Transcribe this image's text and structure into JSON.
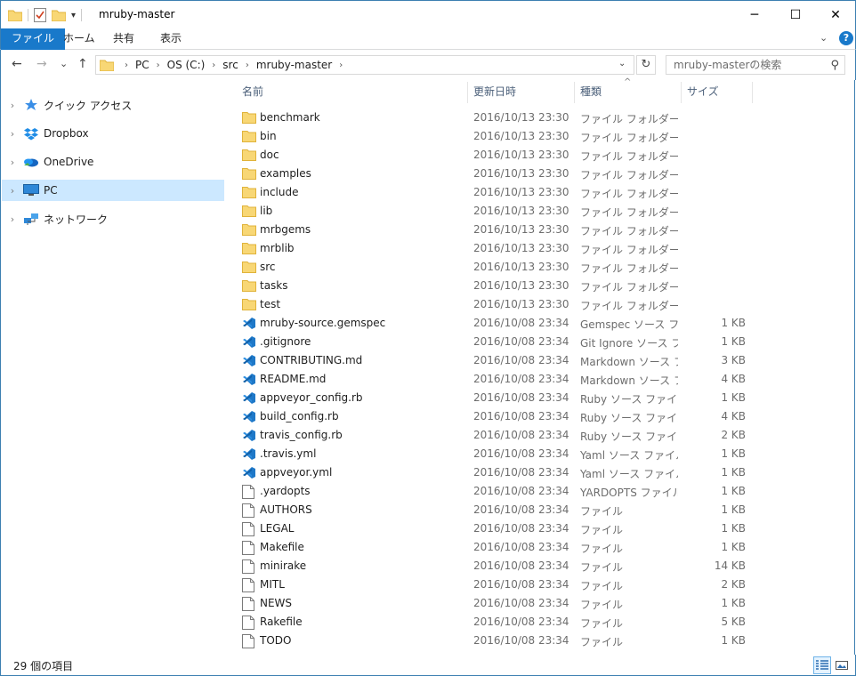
{
  "window": {
    "title": "mruby-master",
    "minimize": "─",
    "maximize": "☐",
    "close": "✕"
  },
  "ribbon": {
    "tabs": [
      "ファイル",
      "ホーム",
      "共有",
      "表示"
    ],
    "expand": "⌄",
    "help": "?"
  },
  "address": {
    "back": "←",
    "forward": "→",
    "recent": "⌄",
    "up": "↑",
    "crumbs": [
      "PC",
      "OS (C:)",
      "src",
      "mruby-master"
    ],
    "dropdown": "⌄",
    "refresh": "↻",
    "search_placeholder": "mruby-masterの検索"
  },
  "nav": {
    "items": [
      {
        "label": "クイック アクセス",
        "icon": "star-icon"
      },
      {
        "label": "Dropbox",
        "icon": "dropbox-icon"
      },
      {
        "label": "OneDrive",
        "icon": "onedrive-icon"
      },
      {
        "label": "PC",
        "icon": "pc-icon",
        "selected": true
      },
      {
        "label": "ネットワーク",
        "icon": "network-icon"
      }
    ]
  },
  "columns": {
    "name": "名前",
    "date": "更新日時",
    "type": "種類",
    "size": "サイズ",
    "sort_indicator": "^"
  },
  "files": [
    {
      "name": "benchmark",
      "date": "2016/10/13 23:30",
      "type": "ファイル フォルダー",
      "size": "",
      "icon": "folder"
    },
    {
      "name": "bin",
      "date": "2016/10/13 23:30",
      "type": "ファイル フォルダー",
      "size": "",
      "icon": "folder"
    },
    {
      "name": "doc",
      "date": "2016/10/13 23:30",
      "type": "ファイル フォルダー",
      "size": "",
      "icon": "folder"
    },
    {
      "name": "examples",
      "date": "2016/10/13 23:30",
      "type": "ファイル フォルダー",
      "size": "",
      "icon": "folder"
    },
    {
      "name": "include",
      "date": "2016/10/13 23:30",
      "type": "ファイル フォルダー",
      "size": "",
      "icon": "folder"
    },
    {
      "name": "lib",
      "date": "2016/10/13 23:30",
      "type": "ファイル フォルダー",
      "size": "",
      "icon": "folder"
    },
    {
      "name": "mrbgems",
      "date": "2016/10/13 23:30",
      "type": "ファイル フォルダー",
      "size": "",
      "icon": "folder"
    },
    {
      "name": "mrblib",
      "date": "2016/10/13 23:30",
      "type": "ファイル フォルダー",
      "size": "",
      "icon": "folder"
    },
    {
      "name": "src",
      "date": "2016/10/13 23:30",
      "type": "ファイル フォルダー",
      "size": "",
      "icon": "folder"
    },
    {
      "name": "tasks",
      "date": "2016/10/13 23:30",
      "type": "ファイル フォルダー",
      "size": "",
      "icon": "folder"
    },
    {
      "name": "test",
      "date": "2016/10/13 23:30",
      "type": "ファイル フォルダー",
      "size": "",
      "icon": "folder"
    },
    {
      "name": "mruby-source.gemspec",
      "date": "2016/10/08 23:34",
      "type": "Gemspec ソース ファ...",
      "size": "1 KB",
      "icon": "vscode"
    },
    {
      "name": ".gitignore",
      "date": "2016/10/08 23:34",
      "type": "Git Ignore ソース フ...",
      "size": "1 KB",
      "icon": "vscode"
    },
    {
      "name": "CONTRIBUTING.md",
      "date": "2016/10/08 23:34",
      "type": "Markdown ソース フ...",
      "size": "3 KB",
      "icon": "vscode"
    },
    {
      "name": "README.md",
      "date": "2016/10/08 23:34",
      "type": "Markdown ソース フ...",
      "size": "4 KB",
      "icon": "vscode"
    },
    {
      "name": "appveyor_config.rb",
      "date": "2016/10/08 23:34",
      "type": "Ruby ソース ファイル",
      "size": "1 KB",
      "icon": "vscode"
    },
    {
      "name": "build_config.rb",
      "date": "2016/10/08 23:34",
      "type": "Ruby ソース ファイル",
      "size": "4 KB",
      "icon": "vscode"
    },
    {
      "name": "travis_config.rb",
      "date": "2016/10/08 23:34",
      "type": "Ruby ソース ファイル",
      "size": "2 KB",
      "icon": "vscode"
    },
    {
      "name": ".travis.yml",
      "date": "2016/10/08 23:34",
      "type": "Yaml ソース ファイル",
      "size": "1 KB",
      "icon": "vscode"
    },
    {
      "name": "appveyor.yml",
      "date": "2016/10/08 23:34",
      "type": "Yaml ソース ファイル",
      "size": "1 KB",
      "icon": "vscode"
    },
    {
      "name": ".yardopts",
      "date": "2016/10/08 23:34",
      "type": "YARDOPTS ファイル",
      "size": "1 KB",
      "icon": "file"
    },
    {
      "name": "AUTHORS",
      "date": "2016/10/08 23:34",
      "type": "ファイル",
      "size": "1 KB",
      "icon": "file"
    },
    {
      "name": "LEGAL",
      "date": "2016/10/08 23:34",
      "type": "ファイル",
      "size": "1 KB",
      "icon": "file"
    },
    {
      "name": "Makefile",
      "date": "2016/10/08 23:34",
      "type": "ファイル",
      "size": "1 KB",
      "icon": "file"
    },
    {
      "name": "minirake",
      "date": "2016/10/08 23:34",
      "type": "ファイル",
      "size": "14 KB",
      "icon": "file"
    },
    {
      "name": "MITL",
      "date": "2016/10/08 23:34",
      "type": "ファイル",
      "size": "2 KB",
      "icon": "file"
    },
    {
      "name": "NEWS",
      "date": "2016/10/08 23:34",
      "type": "ファイル",
      "size": "1 KB",
      "icon": "file"
    },
    {
      "name": "Rakefile",
      "date": "2016/10/08 23:34",
      "type": "ファイル",
      "size": "5 KB",
      "icon": "file"
    },
    {
      "name": "TODO",
      "date": "2016/10/08 23:34",
      "type": "ファイル",
      "size": "1 KB",
      "icon": "file"
    }
  ],
  "status": {
    "item_count": "29 個の項目"
  },
  "colors": {
    "accent": "#1979ca",
    "selected_bg": "#cce8ff",
    "folder": "#f8d775",
    "folder_dark": "#e0b33a",
    "vscode": "#1e78c8"
  }
}
